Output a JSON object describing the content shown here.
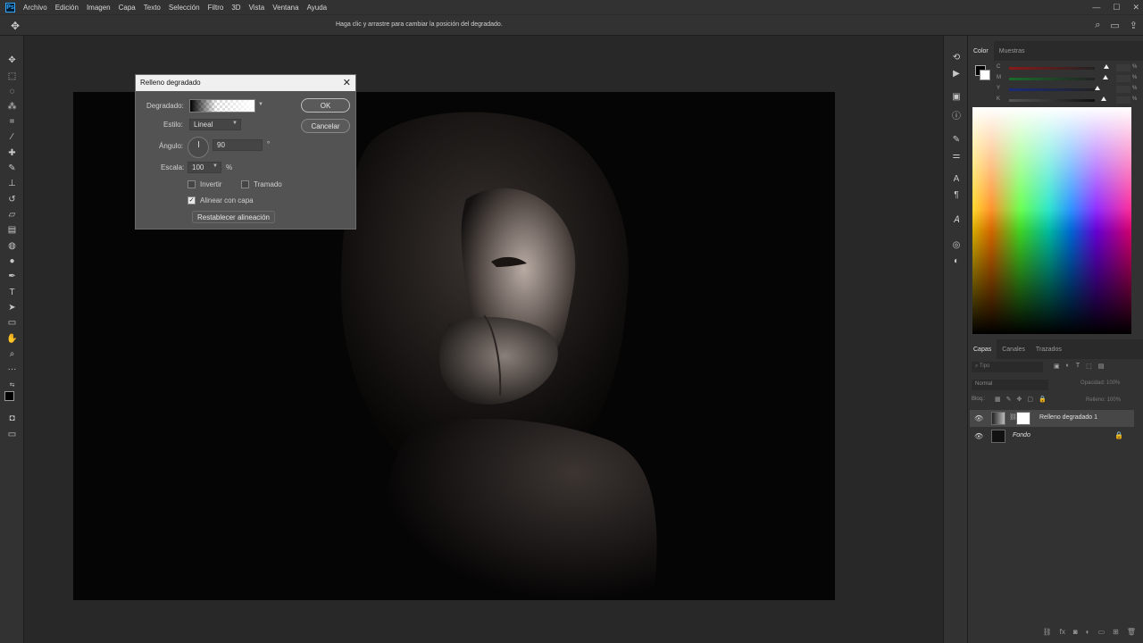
{
  "menubar": {
    "logo": "Ps",
    "items": [
      "Archivo",
      "Edición",
      "Imagen",
      "Capa",
      "Texto",
      "Selección",
      "Filtro",
      "3D",
      "Vista",
      "Ventana",
      "Ayuda"
    ],
    "window_buttons": [
      "—",
      "☐",
      "✕"
    ]
  },
  "optionsbar": {
    "hint": "Haga clic y arrastre para cambiar la posición del degradado."
  },
  "dialog": {
    "title": "Relleno degradado",
    "gradient_label": "Degradado:",
    "style_label": "Estilo:",
    "style_value": "Lineal",
    "angle_label": "Ángulo:",
    "angle_value": "90",
    "angle_unit": "°",
    "scale_label": "Escala:",
    "scale_value": "100",
    "scale_unit": "%",
    "invert_label": "Invertir",
    "invert_checked": false,
    "dither_label": "Tramado",
    "dither_checked": false,
    "align_label": "Alinear con capa",
    "align_checked": true,
    "reset_label": "Restablecer alineación",
    "ok_label": "OK",
    "cancel_label": "Cancelar"
  },
  "color_panel": {
    "tabs": [
      "Color",
      "Muestras"
    ],
    "active_tab": "Color",
    "channels": [
      "C",
      "M",
      "Y",
      "K"
    ],
    "percent": "%"
  },
  "layers_panel": {
    "tabs": [
      "Capas",
      "Canales",
      "Trazados"
    ],
    "active_tab": "Capas",
    "search_placeholder": "Tipo",
    "blend_mode": "Normal",
    "opacity_label": "Opacidad:",
    "opacity_value": "100%",
    "lock_label": "Bloq.:",
    "fill_label": "Relleno:",
    "fill_value": "100%",
    "layers": [
      {
        "name": "Relleno degradado 1",
        "selected": true,
        "visible": true
      },
      {
        "name": "Fondo",
        "selected": false,
        "visible": true,
        "locked": true
      }
    ]
  },
  "colors": {
    "app_bg": "#282828",
    "panel_bg": "#323232",
    "dialog_bg": "#535353",
    "accent": "#31a8ff"
  }
}
